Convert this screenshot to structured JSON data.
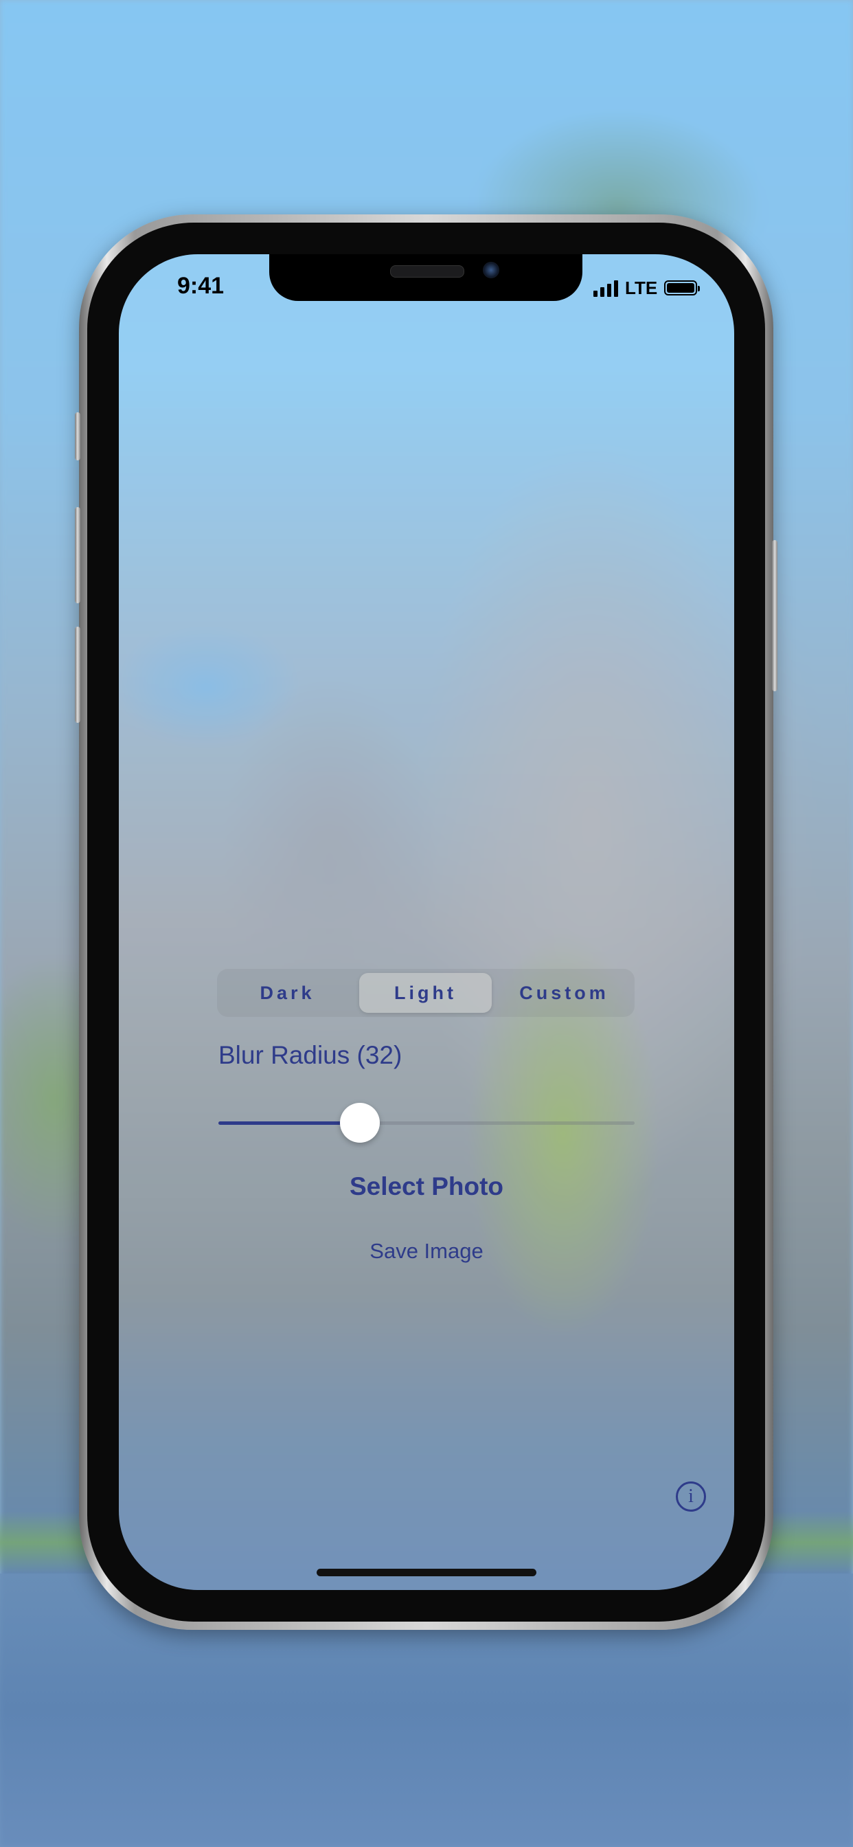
{
  "status_bar": {
    "time": "9:41",
    "network": "LTE",
    "signal_icon": "signal-bars-icon",
    "battery_icon": "battery-icon"
  },
  "segmented_control": {
    "options": [
      "Dark",
      "Light",
      "Custom"
    ],
    "selected": "Light"
  },
  "blur": {
    "label": "Blur Radius (32)",
    "slider_value": 0.34
  },
  "actions": {
    "select_photo": "Select Photo",
    "save_image": "Save Image",
    "info_icon": "info-icon"
  },
  "colors": {
    "accent": "#2e3b8a",
    "thumb": "#ffffff"
  }
}
